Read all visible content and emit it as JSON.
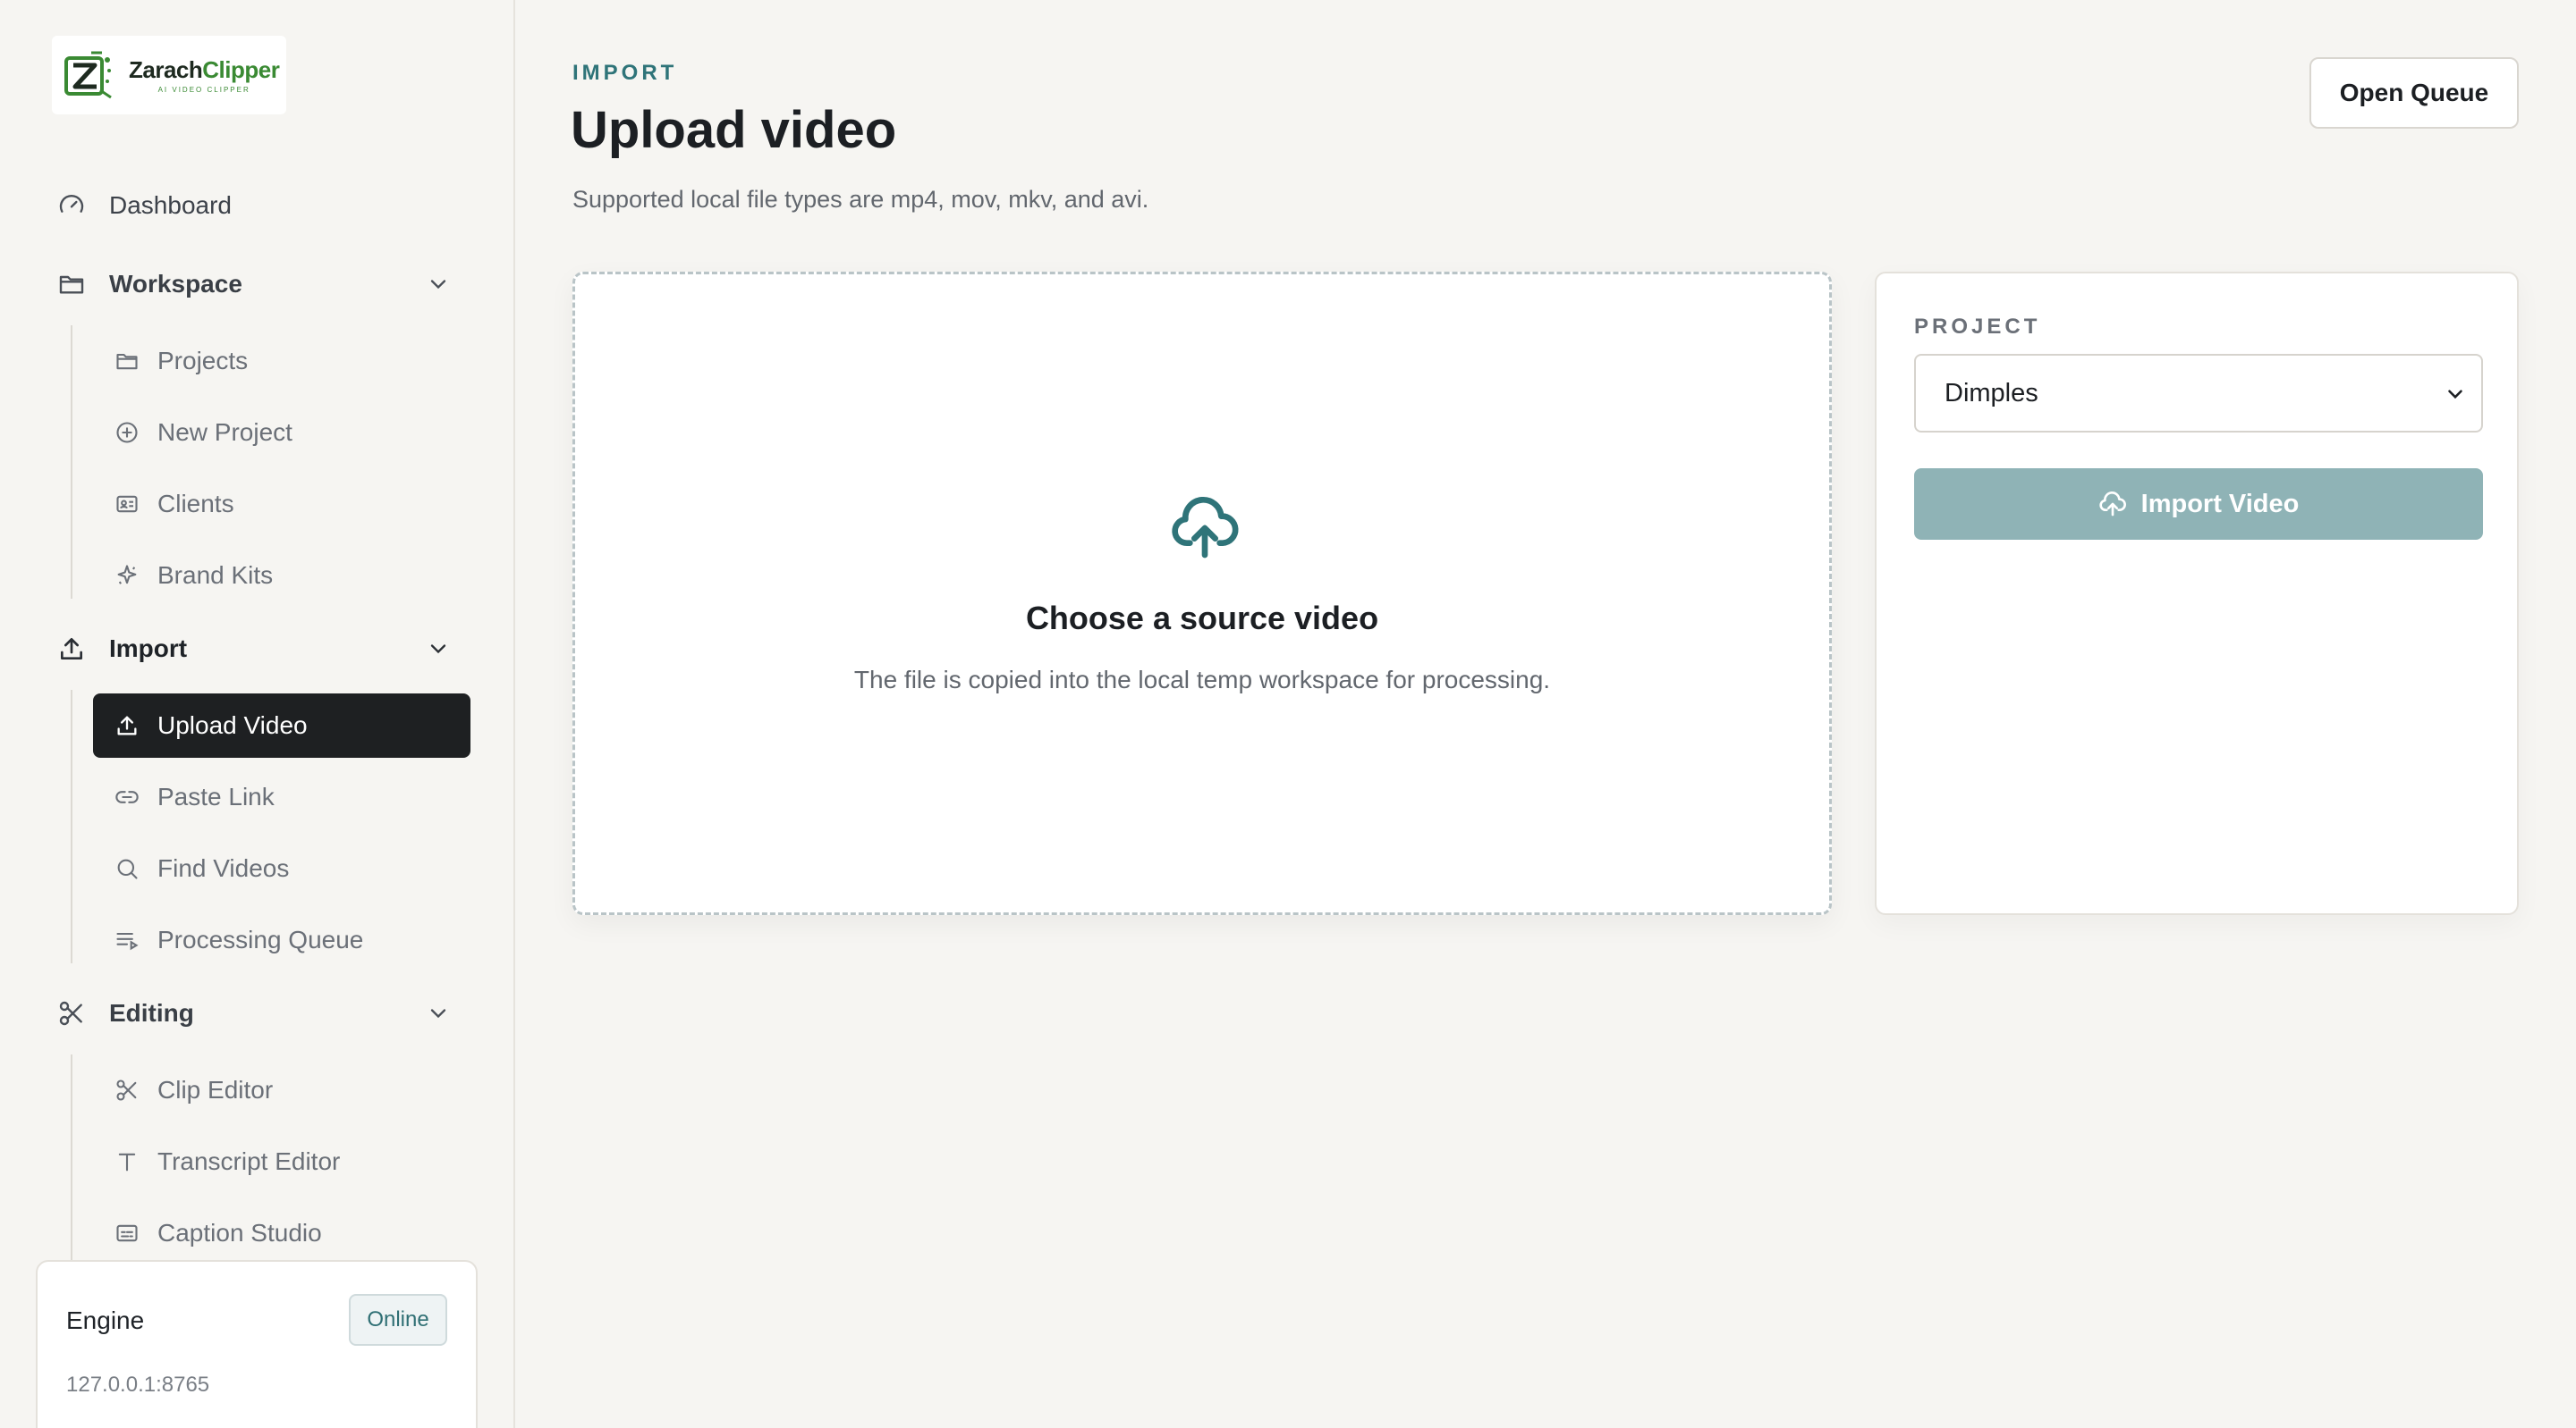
{
  "brand": {
    "name_part1": "Zarach",
    "name_part2": "Clipper",
    "tagline": "AI VIDEO CLIPPER",
    "accent": "#3a8a33"
  },
  "sidebar": {
    "dashboard": {
      "label": "Dashboard",
      "icon": "gauge-icon"
    },
    "workspace": {
      "label": "Workspace",
      "icon": "folder-icon",
      "items": [
        {
          "label": "Projects",
          "icon": "folder-icon"
        },
        {
          "label": "New Project",
          "icon": "plus-circle-icon"
        },
        {
          "label": "Clients",
          "icon": "id-card-icon"
        },
        {
          "label": "Brand Kits",
          "icon": "sparkle-icon"
        }
      ]
    },
    "import": {
      "label": "Import",
      "icon": "upload-icon",
      "items": [
        {
          "label": "Upload Video",
          "icon": "upload-icon",
          "active": true
        },
        {
          "label": "Paste Link",
          "icon": "link-icon"
        },
        {
          "label": "Find Videos",
          "icon": "search-icon"
        },
        {
          "label": "Processing Queue",
          "icon": "queue-icon"
        }
      ]
    },
    "editing": {
      "label": "Editing",
      "icon": "scissors-icon",
      "items": [
        {
          "label": "Clip Editor",
          "icon": "scissors-icon"
        },
        {
          "label": "Transcript Editor",
          "icon": "text-icon"
        },
        {
          "label": "Caption Studio",
          "icon": "captions-icon"
        }
      ]
    },
    "engine": {
      "title": "Engine",
      "status": "Online",
      "address": "127.0.0.1:8765"
    }
  },
  "header": {
    "eyebrow": "IMPORT",
    "title": "Upload video",
    "subtitle": "Supported local file types are mp4, mov, mkv, and avi.",
    "open_queue_label": "Open Queue"
  },
  "dropzone": {
    "title": "Choose a source video",
    "text": "The file is copied into the local temp workspace for processing.",
    "icon": "cloud-upload-icon"
  },
  "project_panel": {
    "label": "PROJECT",
    "selected": "Dimples",
    "import_label": "Import Video"
  },
  "colors": {
    "teal": "#2f7479",
    "button_disabled": "#8fb3b6",
    "active_nav": "#1e2022"
  }
}
